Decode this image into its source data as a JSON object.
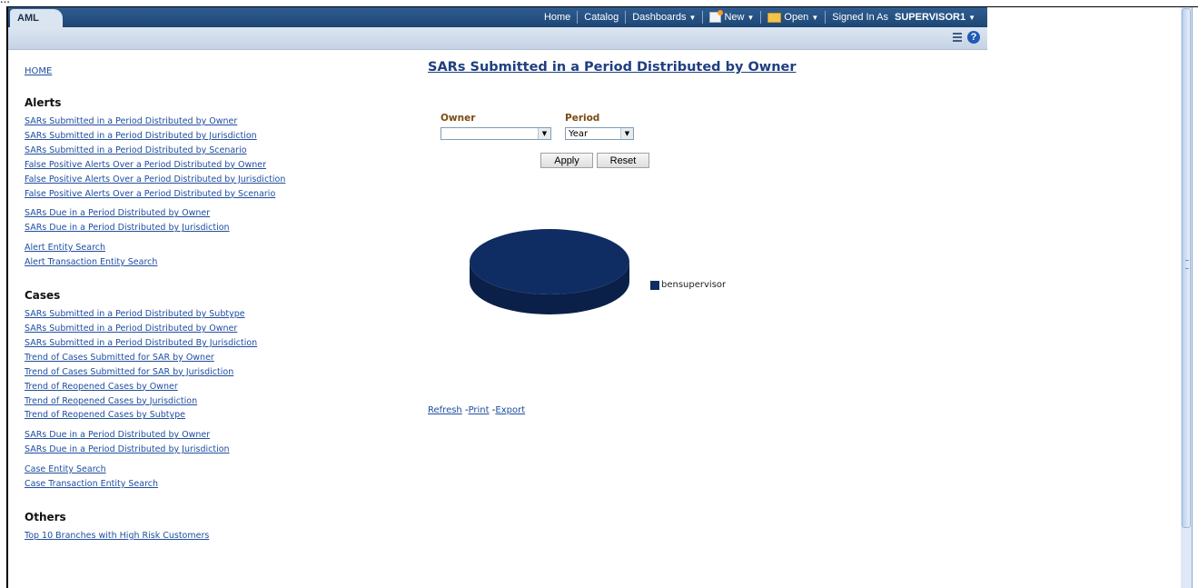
{
  "top_cut_text": "...",
  "header": {
    "app_tab": "AML",
    "nav": {
      "home": "Home",
      "catalog": "Catalog",
      "dashboards": "Dashboards",
      "new": "New",
      "open": "Open",
      "signed_in_prefix": "Signed In As",
      "user": "SUPERVISOR1"
    }
  },
  "sidebar": {
    "home": "HOME",
    "sections": {
      "alerts": {
        "title": "Alerts",
        "group1": [
          "SARs Submitted in a Period Distributed by Owner",
          "SARs Submitted in a Period Distributed by Jurisdiction",
          "SARs Submitted in a Period Distributed by Scenario",
          "False Positive Alerts Over a Period Distributed by Owner",
          "False Positive Alerts Over a Period Distributed by Jurisdiction",
          "False Positive Alerts Over a Period Distributed by Scenario"
        ],
        "group2": [
          "SARs Due in a Period Distributed by Owner",
          "SARs Due in a Period Distributed by Jurisdiction"
        ],
        "group3": [
          "Alert Entity Search",
          "Alert Transaction Entity Search"
        ]
      },
      "cases": {
        "title": "Cases",
        "group1": [
          "SARs Submitted in a Period Distributed by Subtype",
          "SARs Submitted in a Period Distributed by Owner",
          "SARs Submitted in a Period Distributed By Jurisdiction",
          "Trend of Cases Submitted for SAR by Owner",
          "Trend of Cases Submitted for SAR by Jurisdiction",
          "Trend of Reopened Cases by Owner",
          "Trend of Reopened Cases by Jurisdiction",
          "Trend of Reopened Cases by Subtype"
        ],
        "group2": [
          "SARs Due in a Period Distributed by Owner",
          "SARs Due in a Period Distributed by Jurisdiction"
        ],
        "group3": [
          "Case Entity Search",
          "Case Transaction Entity Search"
        ]
      },
      "others": {
        "title": "Others",
        "group1": [
          "Top 10 Branches with High Risk Customers"
        ]
      }
    }
  },
  "main": {
    "title": "SARs Submitted in a Period Distributed by Owner",
    "owner_label": "Owner",
    "owner_value": "",
    "period_label": "Period",
    "period_value": "Year",
    "apply": "Apply",
    "reset": "Reset",
    "legend_item": "bensupervisor",
    "refresh": "Refresh",
    "print": "Print",
    "export": "Export"
  },
  "chart_data": {
    "type": "pie",
    "categories": [
      "bensupervisor"
    ],
    "values": [
      100
    ],
    "colors": [
      "#0f2d63"
    ],
    "title": "",
    "legend_position": "right"
  },
  "colors": {
    "header": "#1d4674",
    "link": "#1f4ea0",
    "pie": "#0f2d63"
  }
}
